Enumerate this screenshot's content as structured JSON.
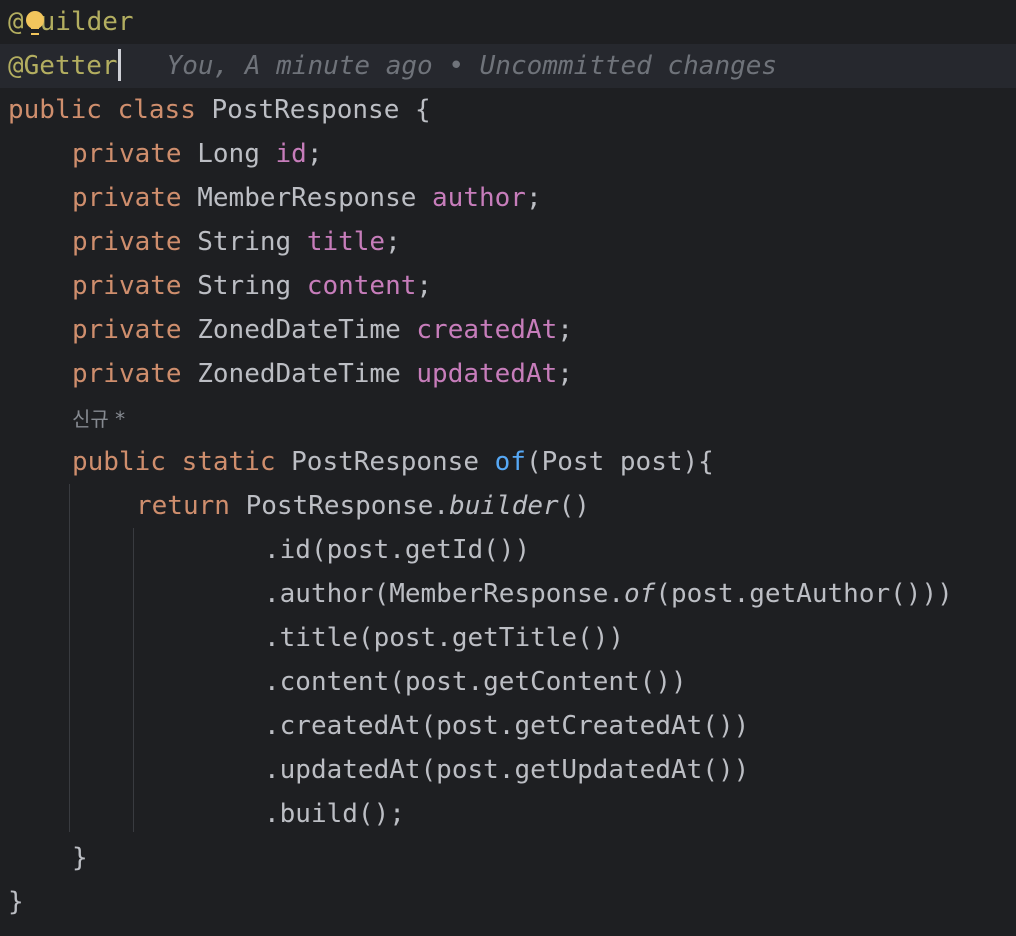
{
  "code": {
    "ann_builder_at": "@",
    "ann_builder_rest": "uilder",
    "ann_getter": "@Getter",
    "blame": "You, A minute ago • Uncommitted changes",
    "class_public": "public",
    "class_class": "class",
    "class_name": " PostResponse {",
    "fields": [
      {
        "modifier": "private",
        "type": " Long ",
        "name": "id",
        "end": ";"
      },
      {
        "modifier": "private",
        "type": " MemberResponse ",
        "name": "author",
        "end": ";"
      },
      {
        "modifier": "private",
        "type": " String ",
        "name": "title",
        "end": ";"
      },
      {
        "modifier": "private",
        "type": " String ",
        "name": "content",
        "end": ";"
      },
      {
        "modifier": "private",
        "type": " ZonedDateTime ",
        "name": "createdAt",
        "end": ";"
      },
      {
        "modifier": "private",
        "type": " ZonedDateTime ",
        "name": "updatedAt",
        "end": ";"
      }
    ],
    "usage_hint": "신규 *",
    "method": {
      "public": "public",
      "static": "static",
      "return_type": " PostResponse ",
      "name": "of",
      "params": "(Post post){"
    },
    "return_kw": "return",
    "return_expr": " PostResponse.",
    "builder_call": "builder",
    "builder_parens": "()",
    "chain": {
      "id": ".id(post.getId())",
      "author_pre": ".author(MemberResponse.",
      "author_of": "of",
      "author_post": "(post.getAuthor()))",
      "title": ".title(post.getTitle())",
      "content": ".content(post.getContent())",
      "createdAt": ".createdAt(post.getCreatedAt())",
      "updatedAt": ".updatedAt(post.getUpdatedAt())",
      "build": ".build();"
    },
    "method_close": "}",
    "class_close": "}"
  },
  "colors": {
    "background": "#1e1f22",
    "keyword": "#cf8e6d",
    "annotation": "#b3ae60",
    "field": "#c77dbb",
    "method_decl": "#56a8f5",
    "text": "#bcbec4",
    "blame": "#6f737a"
  },
  "icons": {
    "intention_bulb": "lightbulb-icon"
  }
}
